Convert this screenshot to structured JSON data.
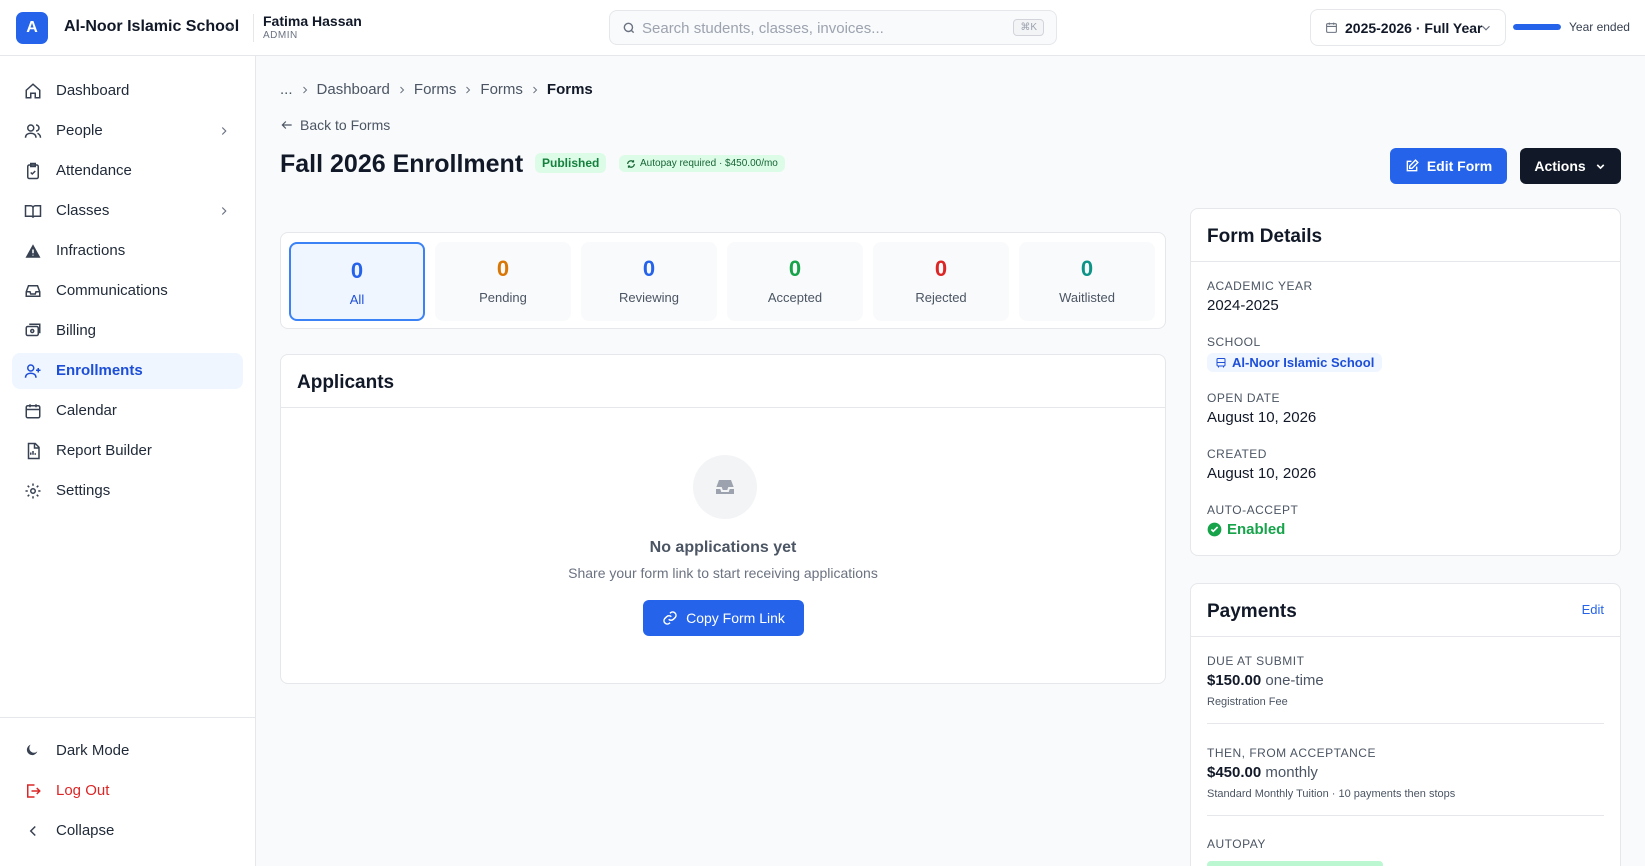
{
  "header": {
    "logo_letter": "A",
    "school_name": "Al-Noor Islamic School",
    "user_name": "Fatima Hassan",
    "user_role": "ADMIN",
    "search_placeholder": "Search students, classes, invoices...",
    "search_shortcut": "⌘K",
    "year_selector": "2025-2026 · Full Year",
    "year_progress_pct": 100,
    "year_status": "Year ended"
  },
  "sidebar": {
    "items": [
      {
        "label": "Dashboard",
        "icon": "home-icon"
      },
      {
        "label": "People",
        "icon": "users-icon"
      },
      {
        "label": "Attendance",
        "icon": "clipboard-check-icon"
      },
      {
        "label": "Classes",
        "icon": "book-open-icon"
      },
      {
        "label": "Infractions",
        "icon": "warning-icon"
      },
      {
        "label": "Communications",
        "icon": "inbox-icon"
      },
      {
        "label": "Billing",
        "icon": "billing-icon"
      },
      {
        "label": "Enrollments",
        "icon": "user-plus-icon"
      },
      {
        "label": "Calendar",
        "icon": "calendar-icon"
      },
      {
        "label": "Report Builder",
        "icon": "file-icon"
      },
      {
        "label": "Settings",
        "icon": "gear-icon"
      }
    ],
    "active": "Enrollments",
    "footer": {
      "dark_mode": "Dark Mode",
      "logout": "Log Out",
      "collapse": "Collapse"
    }
  },
  "breadcrumb": [
    "...",
    "Dashboard",
    "Forms",
    "Forms",
    "Forms"
  ],
  "back_link": "Back to Forms",
  "form": {
    "title": "Fall 2026 Enrollment",
    "status": "Published",
    "autopay_badge": "Autopay required · $450.00/mo",
    "edit_button": "Edit Form",
    "actions_button": "Actions"
  },
  "stats": [
    {
      "label": "All",
      "count": "0",
      "color": "#2563eb"
    },
    {
      "label": "Pending",
      "count": "0",
      "color": "#d97706"
    },
    {
      "label": "Reviewing",
      "count": "0",
      "color": "#2563eb"
    },
    {
      "label": "Accepted",
      "count": "0",
      "color": "#16a34a"
    },
    {
      "label": "Rejected",
      "count": "0",
      "color": "#dc2626"
    },
    {
      "label": "Waitlisted",
      "count": "0",
      "color": "#0d9488"
    }
  ],
  "applicants": {
    "title": "Applicants",
    "empty_title": "No applications yet",
    "empty_subtitle": "Share your form link to start receiving applications",
    "copy_button": "Copy Form Link"
  },
  "details": {
    "title": "Form Details",
    "academic_year_label": "ACADEMIC YEAR",
    "academic_year": "2024-2025",
    "school_label": "SCHOOL",
    "school": "Al-Noor Islamic School",
    "open_date_label": "OPEN DATE",
    "open_date": "August 10, 2026",
    "created_label": "CREATED",
    "created": "August 10, 2026",
    "auto_accept_label": "AUTO-ACCEPT",
    "auto_accept": "Enabled"
  },
  "payments": {
    "title": "Payments",
    "edit": "Edit",
    "due_label": "DUE AT SUBMIT",
    "due_amount": "$150.00",
    "due_type": "one-time",
    "due_desc": "Registration Fee",
    "then_label": "THEN, FROM ACCEPTANCE",
    "then_amount": "$450.00",
    "then_type": "monthly",
    "then_desc": "Standard Monthly Tuition · 10 payments then stops",
    "autopay_label": "AUTOPAY"
  }
}
